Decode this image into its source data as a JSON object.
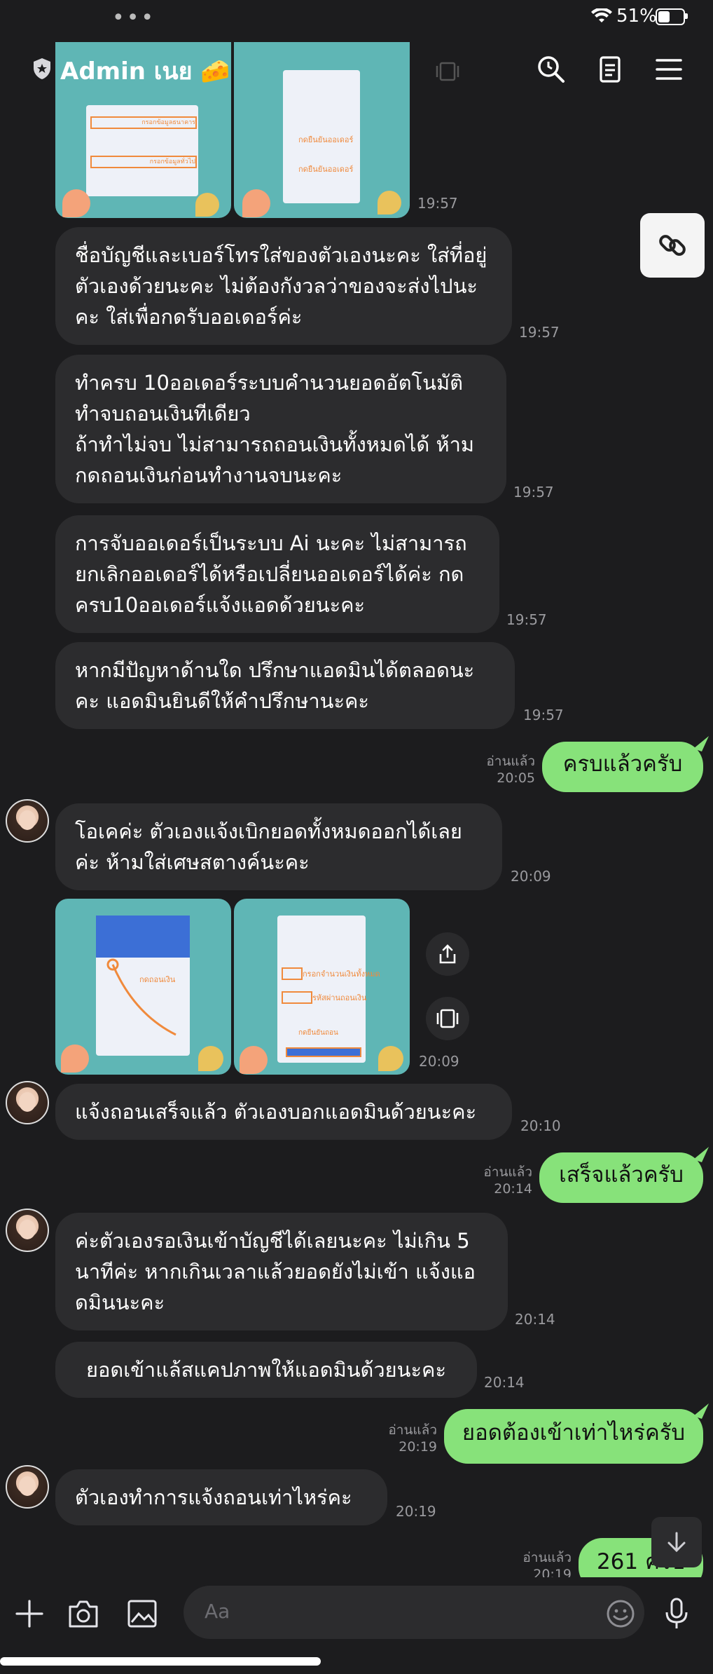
{
  "status_bar": {
    "dots": "•••",
    "battery_pct": "51%"
  },
  "header": {
    "title": "Admin เนย 🧀"
  },
  "messages": [
    {
      "id": "m1",
      "text": "ชื่อบัญชีและเบอร์โทรใส่ของตัวเองนะคะ  ใส่ที่อยู่ตัวเองด้วยนะคะ ไม่ต้องกังวลว่าของจะส่งไปนะคะ ใส่เพื่อกดรับออเดอร์ค่ะ",
      "time": "19:57"
    },
    {
      "id": "m2",
      "text": "ทำครบ 10ออเดอร์ระบบคำนวนยอดอัตโนมัติ ทำจบถอนเงินทีเดียว\nถ้าทำไม่จบ ไม่สามารถถอนเงินทั้งหมดได้ ห้ามกดถอนเงินก่อนทำงานจบนะคะ",
      "time": "19:57"
    },
    {
      "id": "m3",
      "text": "การจับออเดอร์เป็นระบบ Ai นะคะ ไม่สามารถยกเลิกออเดอร์ได้หรือเปลี่ยนออเดอร์ได้ค่ะ กดครบ10ออเดอร์แจ้งแอดด้วยนะคะ",
      "time": "19:57"
    },
    {
      "id": "m4",
      "text": "หากมีปัญหาด้านใด ปรึกษาแอดมินได้ตลอดนะคะ แอดมินยินดีให้คำปรึกษานะคะ",
      "time": "19:57"
    },
    {
      "id": "m5",
      "text": "ครบแล้วครับ",
      "read": "อ่านแล้ว",
      "time": "20:05"
    },
    {
      "id": "m6",
      "text": "โอเคค่ะ ตัวเองแจ้งเบิกยอดทั้งหมดออกได้เลยค่ะ ห้ามใส่เศษสตางค์นะคะ",
      "time": "20:09"
    },
    {
      "id": "img2",
      "time": "20:09",
      "img_text_a": "กดถอนเงิน",
      "img_text_b": "กรอกจำนวนเงินทั้งหมด",
      "img_text_c": "รหัสผ่านถอนเงิน",
      "img_text_d": "กดยืนยันถอน"
    },
    {
      "id": "m7",
      "text": "แจ้งถอนเสร็จแล้ว ตัวเองบอกแอดมินด้วยนะคะ",
      "time": "20:10"
    },
    {
      "id": "m8",
      "text": "เสร็จแล้วครับ",
      "read": "อ่านแล้ว",
      "time": "20:14"
    },
    {
      "id": "m9",
      "text": "ค่ะตัวเองรอเงินเข้าบัญชีได้เลยนะคะ ไม่เกิน 5 นาทีค่ะ หากเกินเวลาแล้วยอดยังไม่เข้า แจ้งแอดมินนะคะ",
      "time": "20:14"
    },
    {
      "id": "m10",
      "text": "ยอดเข้าแล้สแคปภาพให้แอดมินด้วยนะคะ",
      "time": "20:14"
    },
    {
      "id": "m11",
      "text": "ยอดต้องเข้าเท่าไหร่ครับ",
      "read": "อ่านแล้ว",
      "time": "20:19"
    },
    {
      "id": "m12",
      "text": "ตัวเองทำการแจ้งถอนเท่าไหร่คะ",
      "time": "20:19"
    },
    {
      "id": "m13",
      "text": "261 ครับ",
      "read": "อ่านแล้ว",
      "time": "20:19"
    }
  ],
  "img1": {
    "time": "19:57",
    "label_a": "กรอกข้อมูลธนาคาร",
    "label_b": "กรอกข้อมูลทั่วไป",
    "label_c": "กดยืนยันออเดอร์",
    "label_d": "กดยืนยันออเดอร์"
  },
  "composer": {
    "placeholder": "Aa"
  },
  "colors": {
    "background": "#1c1c1e",
    "bubble_incoming": "#2c2c2e",
    "bubble_outgoing": "#87e27a"
  }
}
